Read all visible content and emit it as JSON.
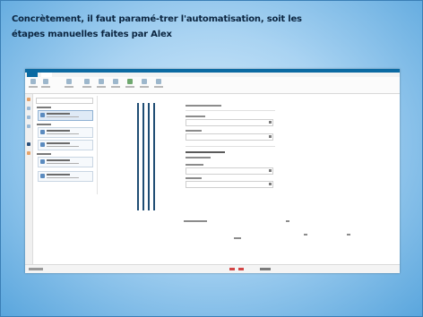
{
  "slide": {
    "title_line1": "Concrètement, il faut paramé-trer  l'automatisation, soit les",
    "title_line2": "étapes manuelles faites par Alex"
  },
  "colors": {
    "titlebar": "#0b6aa2",
    "accent_line": "#1f4d74",
    "status_red": "#d24646"
  }
}
